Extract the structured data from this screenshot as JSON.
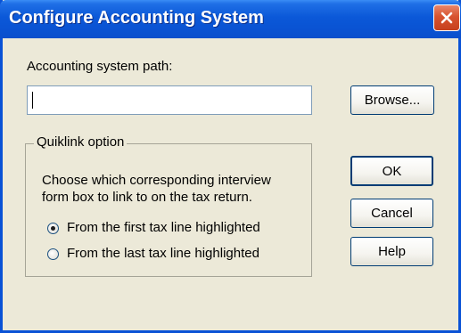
{
  "window": {
    "title": "Configure Accounting System"
  },
  "path": {
    "label": "Accounting system path:",
    "value": "",
    "browse_label": "Browse..."
  },
  "quiklink": {
    "legend": "Quiklink option",
    "description_line1": "Choose which corresponding interview",
    "description_line2": "form box to link to on the tax return.",
    "options": [
      {
        "label": "From the first tax line highlighted",
        "selected": true
      },
      {
        "label": "From the last tax line highlighted",
        "selected": false
      }
    ]
  },
  "buttons": {
    "ok": "OK",
    "cancel": "Cancel",
    "help": "Help"
  },
  "colors": {
    "titlebar": "#0a53d3",
    "dialog_bg": "#ece9d8",
    "close_button": "#d8532f"
  },
  "icons": {
    "close": "close-icon"
  }
}
